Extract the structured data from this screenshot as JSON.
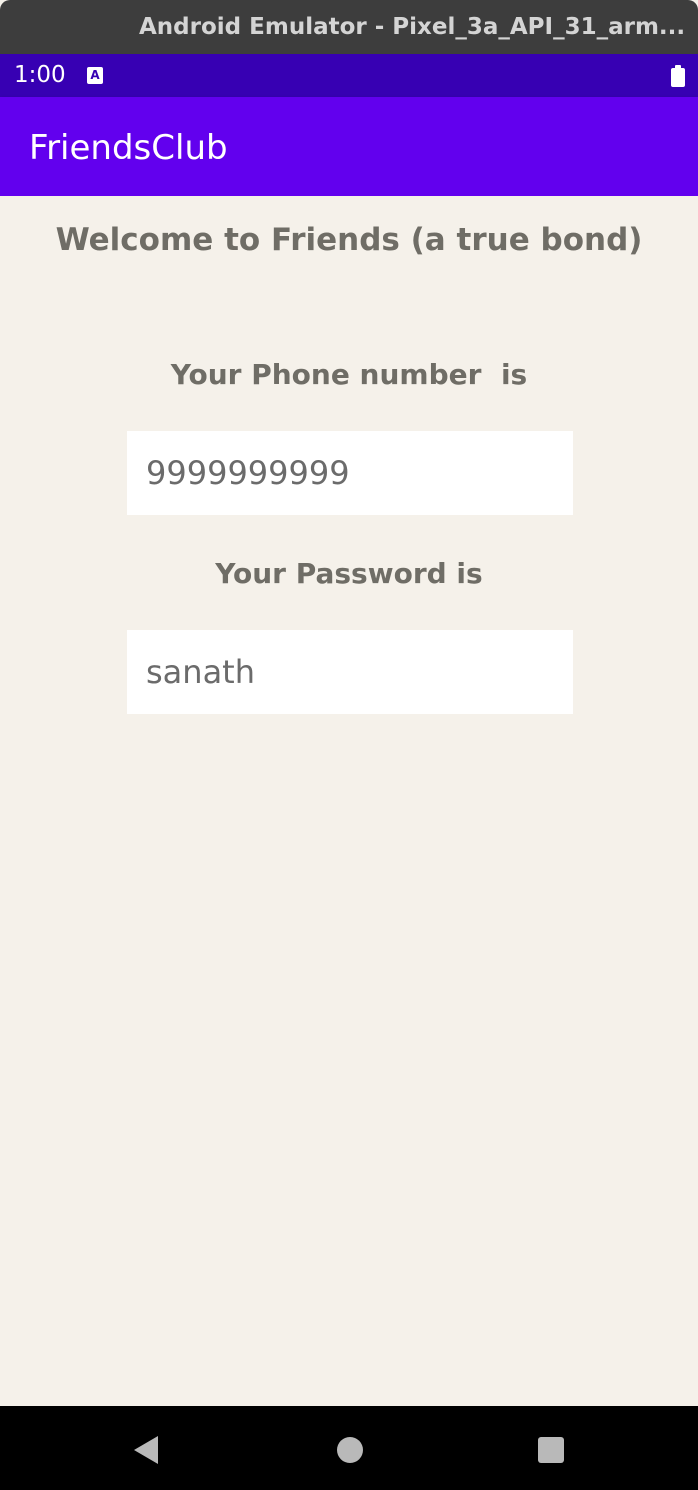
{
  "window": {
    "title": "Android Emulator - Pixel_3a_API_31_arm..."
  },
  "status_bar": {
    "time": "1:00",
    "notification_icon_letter": "A",
    "icons": [
      "notification-a-icon",
      "battery-icon"
    ]
  },
  "app_bar": {
    "title": "FriendsClub"
  },
  "main": {
    "welcome_text": "Welcome to Friends (a true bond)",
    "phone_label": "Your Phone number  is",
    "phone_value": "9999999999",
    "password_label": "Your Password is",
    "password_value": "sanath"
  },
  "nav_bar": {
    "icons": [
      "back-icon",
      "home-icon",
      "recents-icon"
    ]
  },
  "colors": {
    "status_bar": "#3700b3",
    "app_bar": "#6200ee",
    "background": "#f5f1ea",
    "text": "#6f6d66"
  }
}
